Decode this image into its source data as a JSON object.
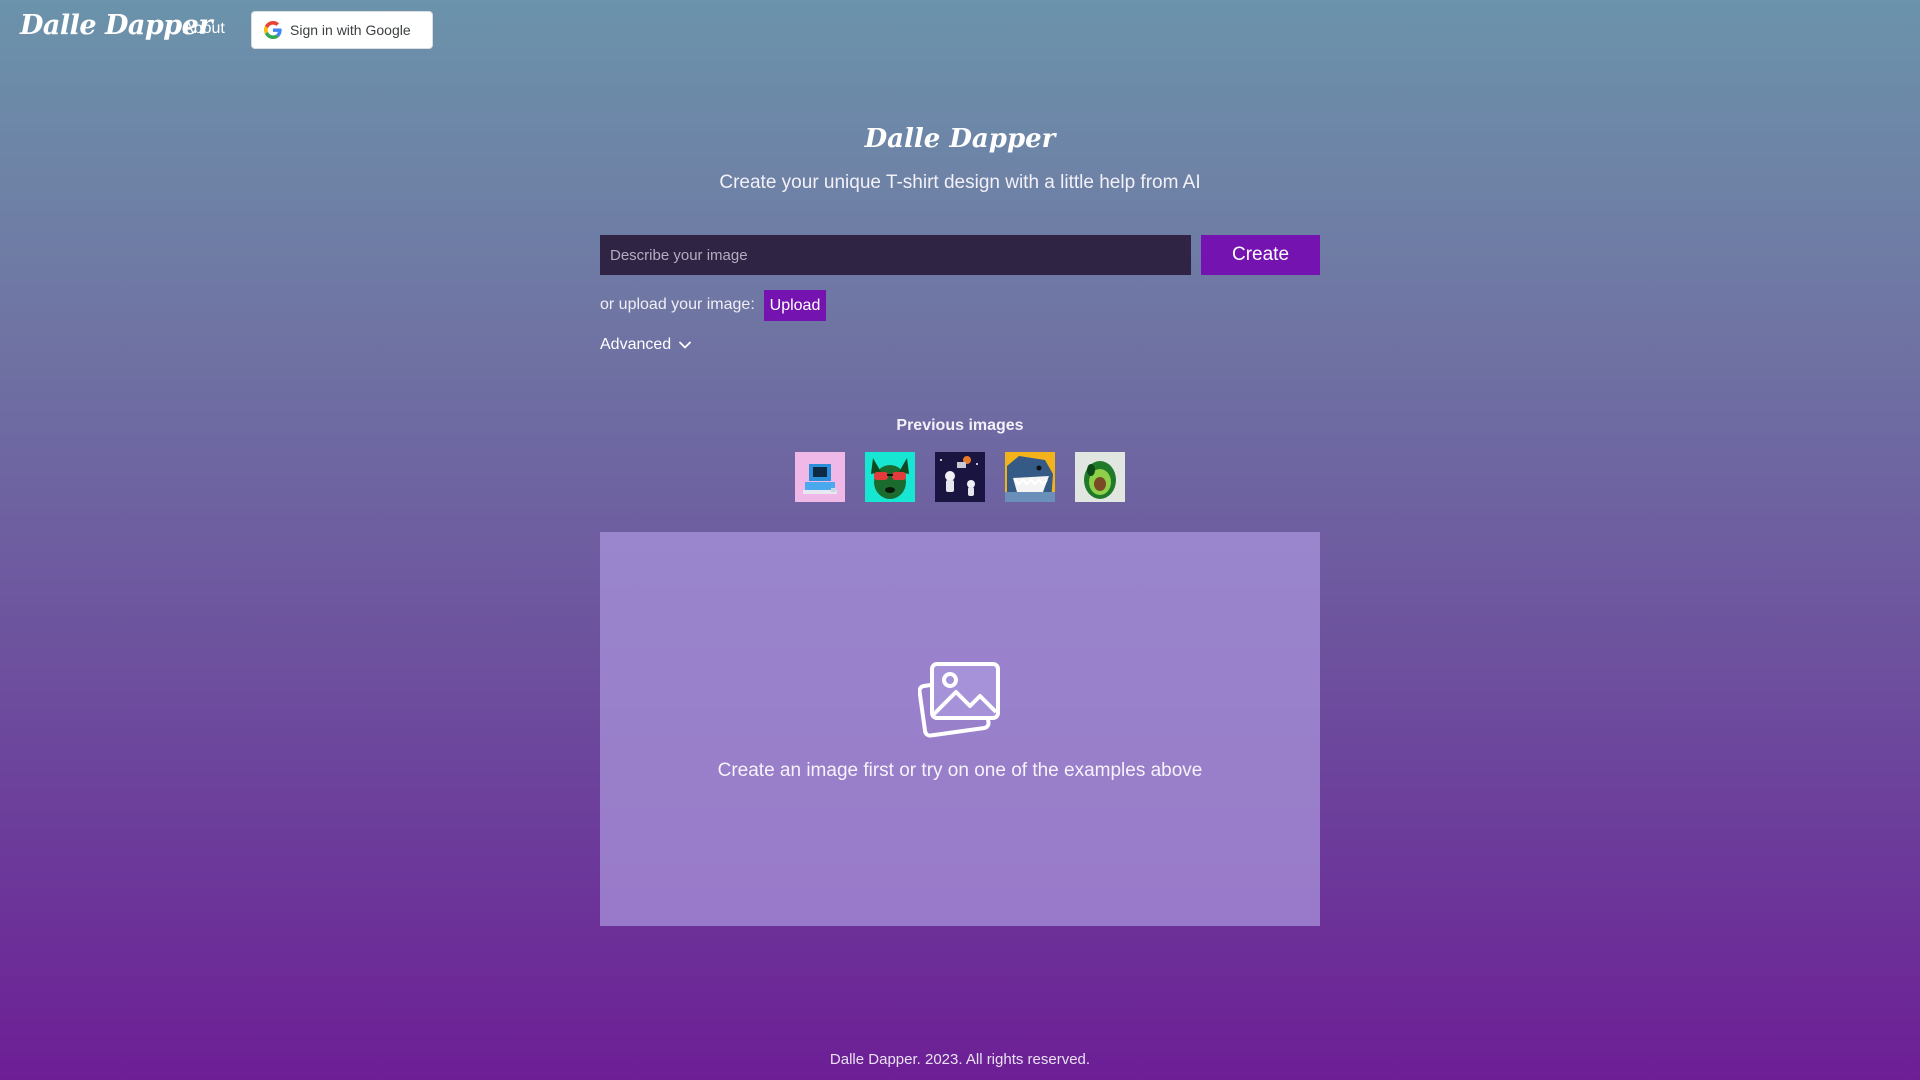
{
  "header": {
    "brand": "Dalle Dapper",
    "about_label": "About",
    "google_signin_label": "Sign in with Google"
  },
  "hero": {
    "title": "Dalle Dapper",
    "subtitle": "Create your unique T-shirt design with a little help from AI"
  },
  "prompt": {
    "placeholder": "Describe your image",
    "value": "",
    "create_label": "Create"
  },
  "upload": {
    "label": "or upload your image:",
    "button_label": "Upload"
  },
  "advanced": {
    "label": "Advanced",
    "icon": "chevron-down-icon"
  },
  "previous_images": {
    "heading": "Previous images",
    "items": [
      {
        "name": "thumb-retro-computer",
        "icon": "image-thumbnail"
      },
      {
        "name": "thumb-dog-sunglasses",
        "icon": "image-thumbnail"
      },
      {
        "name": "thumb-astronauts-space",
        "icon": "image-thumbnail"
      },
      {
        "name": "thumb-shark",
        "icon": "image-thumbnail"
      },
      {
        "name": "thumb-avocado",
        "icon": "image-thumbnail"
      }
    ]
  },
  "preview": {
    "icon": "image-placeholder-icon",
    "message": "Create an image first or try on one of the examples above"
  },
  "footer": {
    "text": "Dalle Dapper. 2023. All rights reserved."
  },
  "colors": {
    "accent": "#7413b0",
    "input_bg": "#2f2444",
    "gradient_top": "#6b93ab",
    "gradient_bottom": "#6d1e95"
  }
}
